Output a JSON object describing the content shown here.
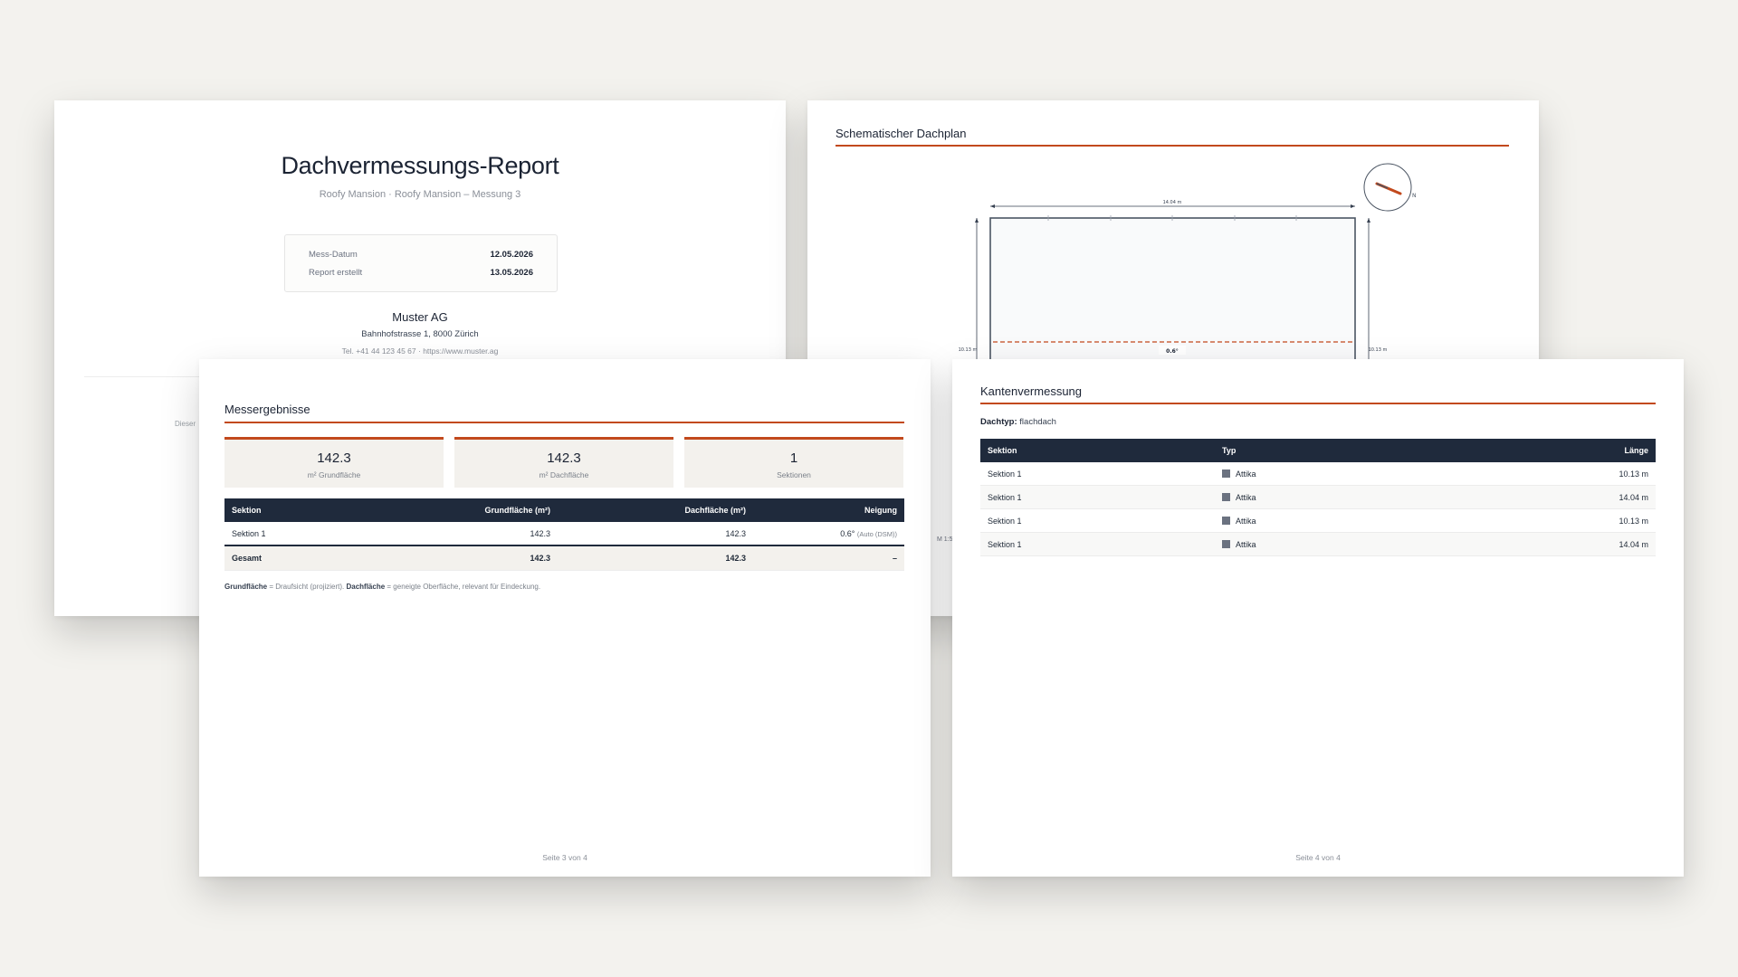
{
  "cover": {
    "title": "Dachvermessungs-Report",
    "subtitle": "Roofy Mansion · Roofy Mansion – Messung 3",
    "meta": [
      {
        "label": "Mess-Datum",
        "value": "12.05.2026"
      },
      {
        "label": "Report erstellt",
        "value": "13.05.2026"
      }
    ],
    "company": "Muster AG",
    "address": "Bahnhofstrasse 1, 8000 Zürich",
    "contact": "Tel. +41 44 123 45 67 · https://www.muster.ag",
    "note_fragment": "Dieser"
  },
  "plan": {
    "title": "Schematischer Dachplan",
    "width_label": "14.04 m",
    "left_label": "10.13 m",
    "right_label": "10.13 m",
    "slope_label": "0.6°",
    "compass_letter": "N",
    "scale_note": "M 1:5",
    "colors": {
      "accent": "#c2491d",
      "line": "#4b5563"
    }
  },
  "results": {
    "title": "Messergebnisse",
    "kpis": [
      {
        "value": "142.3",
        "label": "m² Grundfläche"
      },
      {
        "value": "142.3",
        "label": "m² Dachfläche"
      },
      {
        "value": "1",
        "label": "Sektionen"
      }
    ],
    "table": {
      "headers": [
        "Sektion",
        "Grundfläche (m²)",
        "Dachfläche (m²)",
        "Neigung"
      ],
      "row": {
        "section": "Sektion 1",
        "ground": "142.3",
        "roof": "142.3",
        "slope": "0.6°",
        "slope_note": "(Auto (DSM))"
      },
      "total": {
        "label": "Gesamt",
        "ground": "142.3",
        "roof": "142.3",
        "slope": "–"
      }
    },
    "footnote": {
      "term1": "Grundfläche",
      "text1": " = Draufsicht (projiziert). ",
      "term2": "Dachfläche",
      "text2": " = geneigte Oberfläche, relevant für Eindeckung."
    },
    "footer": "Seite 3 von 4"
  },
  "edges": {
    "title": "Kantenvermessung",
    "roof_type_label": "Dachtyp:",
    "roof_type_value": "flachdach",
    "headers": [
      "Sektion",
      "Typ",
      "Länge"
    ],
    "rows": [
      {
        "section": "Sektion 1",
        "type": "Attika",
        "length": "10.13 m"
      },
      {
        "section": "Sektion 1",
        "type": "Attika",
        "length": "14.04 m"
      },
      {
        "section": "Sektion 1",
        "type": "Attika",
        "length": "10.13 m"
      },
      {
        "section": "Sektion 1",
        "type": "Attika",
        "length": "14.04 m"
      }
    ],
    "footer": "Seite 4 von 4"
  }
}
